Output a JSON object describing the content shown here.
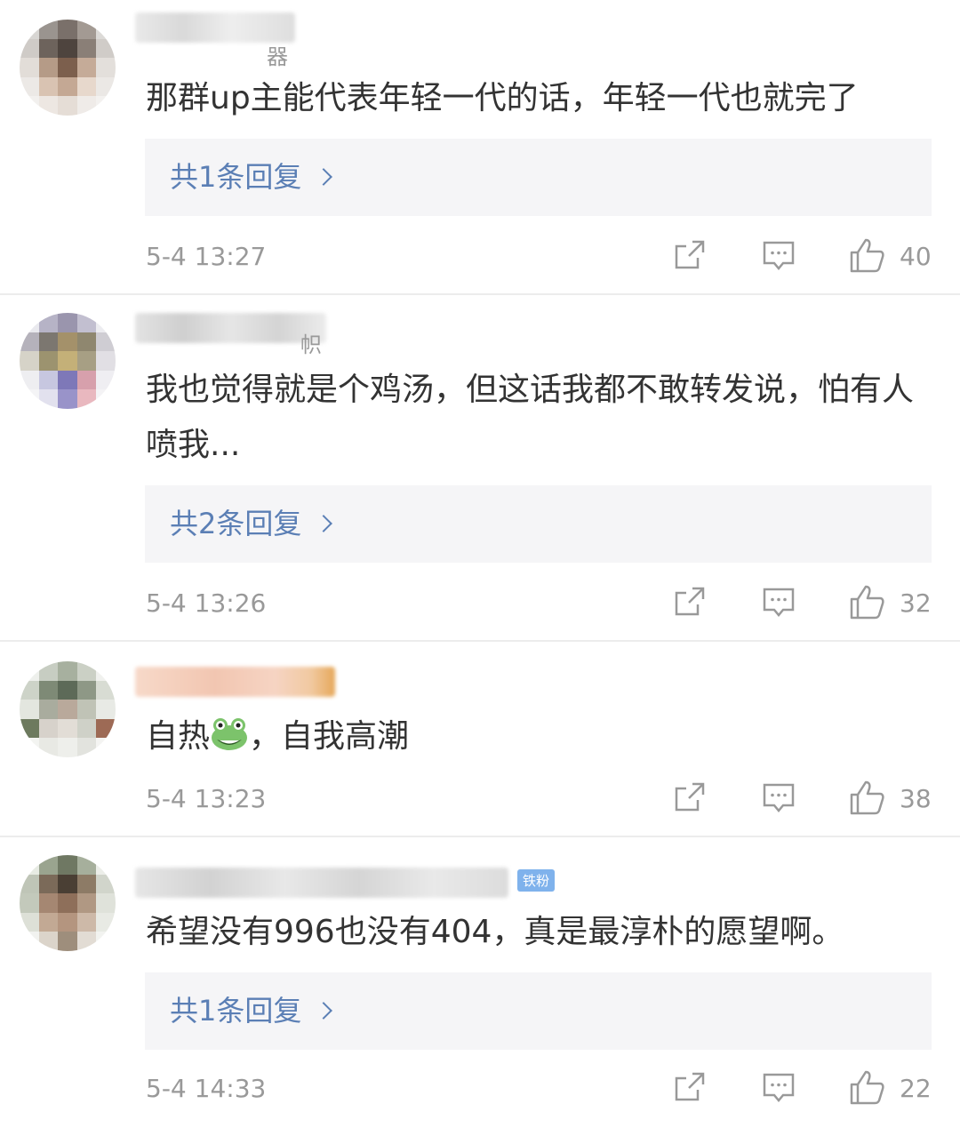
{
  "comments": [
    {
      "name_suffix": "器",
      "text": "那群up主能代表年轻一代的话，年轻一代也就完了",
      "reply_label": "共1条回复",
      "time": "5-4 13:27",
      "likes": "40"
    },
    {
      "name_suffix": "帜",
      "text": "我也觉得就是个鸡汤，但这话我都不敢转发说，怕有人喷我...",
      "reply_label": "共2条回复",
      "time": "5-4 13:26",
      "likes": "32"
    },
    {
      "text_before": "自热",
      "text_after": "，自我高潮",
      "emoji": "frog-emoji",
      "time": "5-4 13:23",
      "likes": "38"
    },
    {
      "badge": "铁粉",
      "text": "希望没有996也没有404，真是最淳朴的愿望啊。",
      "reply_label": "共1条回复",
      "time": "5-4 14:33",
      "likes": "22"
    }
  ],
  "icons": {
    "share": "share-icon",
    "comment": "comment-icon",
    "like": "thumbs-up-icon"
  },
  "colors": {
    "link": "#5b7fb5",
    "meta": "#999999",
    "text": "#333333",
    "reply_bg": "#f5f5f7"
  }
}
